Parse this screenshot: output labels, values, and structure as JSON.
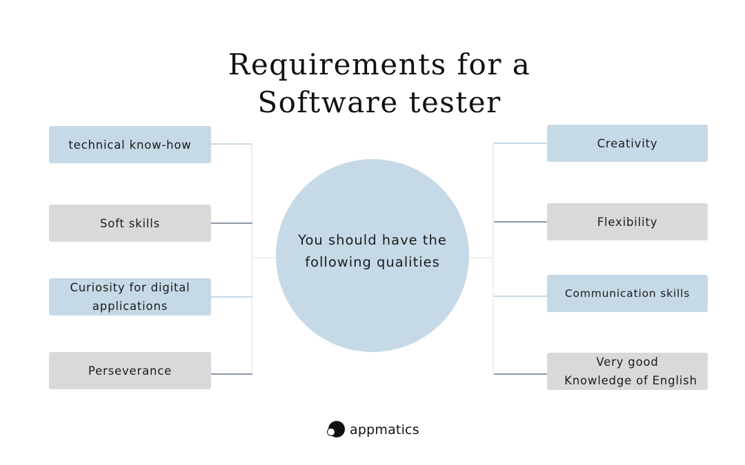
{
  "title": {
    "line1": "Requirements for a",
    "line2": "Software tester"
  },
  "center": {
    "text_line1": "You should have the",
    "text_line2": "following qualities"
  },
  "left_items": [
    {
      "line1": "technical know-how",
      "line2": "",
      "color": "blue"
    },
    {
      "line1": "Soft skills",
      "line2": "",
      "color": "gray"
    },
    {
      "line1": "Curiosity for digital",
      "line2": "applications",
      "color": "blue"
    },
    {
      "line1": "Perseverance",
      "line2": "",
      "color": "gray"
    }
  ],
  "right_items": [
    {
      "line1": "Creativity",
      "line2": "",
      "color": "blue"
    },
    {
      "line1": "Flexibility",
      "line2": "",
      "color": "gray"
    },
    {
      "line1": "Communication skills",
      "line2": "",
      "color": "blue"
    },
    {
      "line1": "Very good",
      "line2": "Knowledge of English",
      "color": "gray"
    }
  ],
  "colors": {
    "blue": "#c6d9e6",
    "gray": "#d9d9d9",
    "connector_gray": "#8c99a5",
    "connector_light": "#eeeeee"
  },
  "logo": {
    "icon": "appmatics-logo-icon",
    "text": "appmatics"
  }
}
